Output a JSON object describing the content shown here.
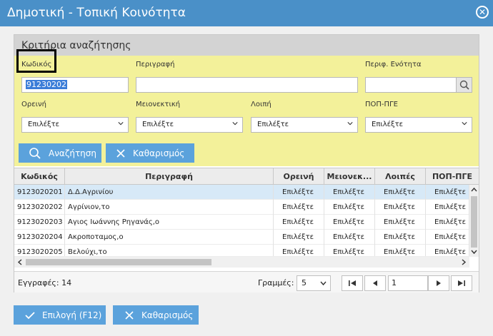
{
  "window": {
    "title": "Δημοτική - Τοπική Κοινότητα"
  },
  "criteria": {
    "header": "Κριτήρια αναζήτησης",
    "code_label": "Κωδικός",
    "code_value": "91230202",
    "description_label": "Περιγραφή",
    "description_value": "",
    "unit_label": "Περιφ. Ενότητα",
    "unit_value": "",
    "mountain_label": "Ορεινή",
    "minority_label": "Μειονεκτική",
    "other_label": "Λοιπή",
    "pop_label": "ΠΟΠ-ΠΓΕ",
    "select_placeholder": "Επιλέξτε",
    "search_button": "Αναζήτηση",
    "clear_button": "Καθαρισμός"
  },
  "grid": {
    "columns": [
      "Κωδικός",
      "Περιγραφή",
      "Ορεινή",
      "Μειονεκ...",
      "Λοιπές",
      "ΠΟΠ-ΠΓΕ"
    ],
    "rows": [
      {
        "code": "9123020201",
        "description": "Δ.Δ.Αγρινίου",
        "mountain": "Επιλέξτε",
        "minority": "Επιλέξτε",
        "other": "Επιλέξτε",
        "pop": "Επιλέξτε"
      },
      {
        "code": "9123020202",
        "description": "Αγρίνιον,το",
        "mountain": "Επιλέξτε",
        "minority": "Επιλέξτε",
        "other": "Επιλέξτε",
        "pop": "Επιλέξτε"
      },
      {
        "code": "9123020203",
        "description": "Αγιος Ιωάννης Ρηγανάς,ο",
        "mountain": "Επιλέξτε",
        "minority": "Επιλέξτε",
        "other": "Επιλέξτε",
        "pop": "Επιλέξτε"
      },
      {
        "code": "9123020204",
        "description": "Ακροποταμος,ο",
        "mountain": "Επιλέξτε",
        "minority": "Επιλέξτε",
        "other": "Επιλέξτε",
        "pop": "Επιλέξτε"
      },
      {
        "code": "9123020205",
        "description": "Βελούχι,το",
        "mountain": "Επιλέξτε",
        "minority": "Επιλέξτε",
        "other": "Επιλέξτε",
        "pop": "Επιλέξτε"
      }
    ]
  },
  "footer": {
    "records_label": "Εγγραφές: 14",
    "rows_label": "Γραμμές:",
    "rows_value": "5",
    "page_value": "1"
  },
  "actions": {
    "select_button": "Επιλογή (F12)",
    "clear_button": "Καθαρισμός"
  },
  "colors": {
    "titlebar": "#4a90c8",
    "criteria_bg": "#f3f19a",
    "button": "#5ba2dc"
  }
}
